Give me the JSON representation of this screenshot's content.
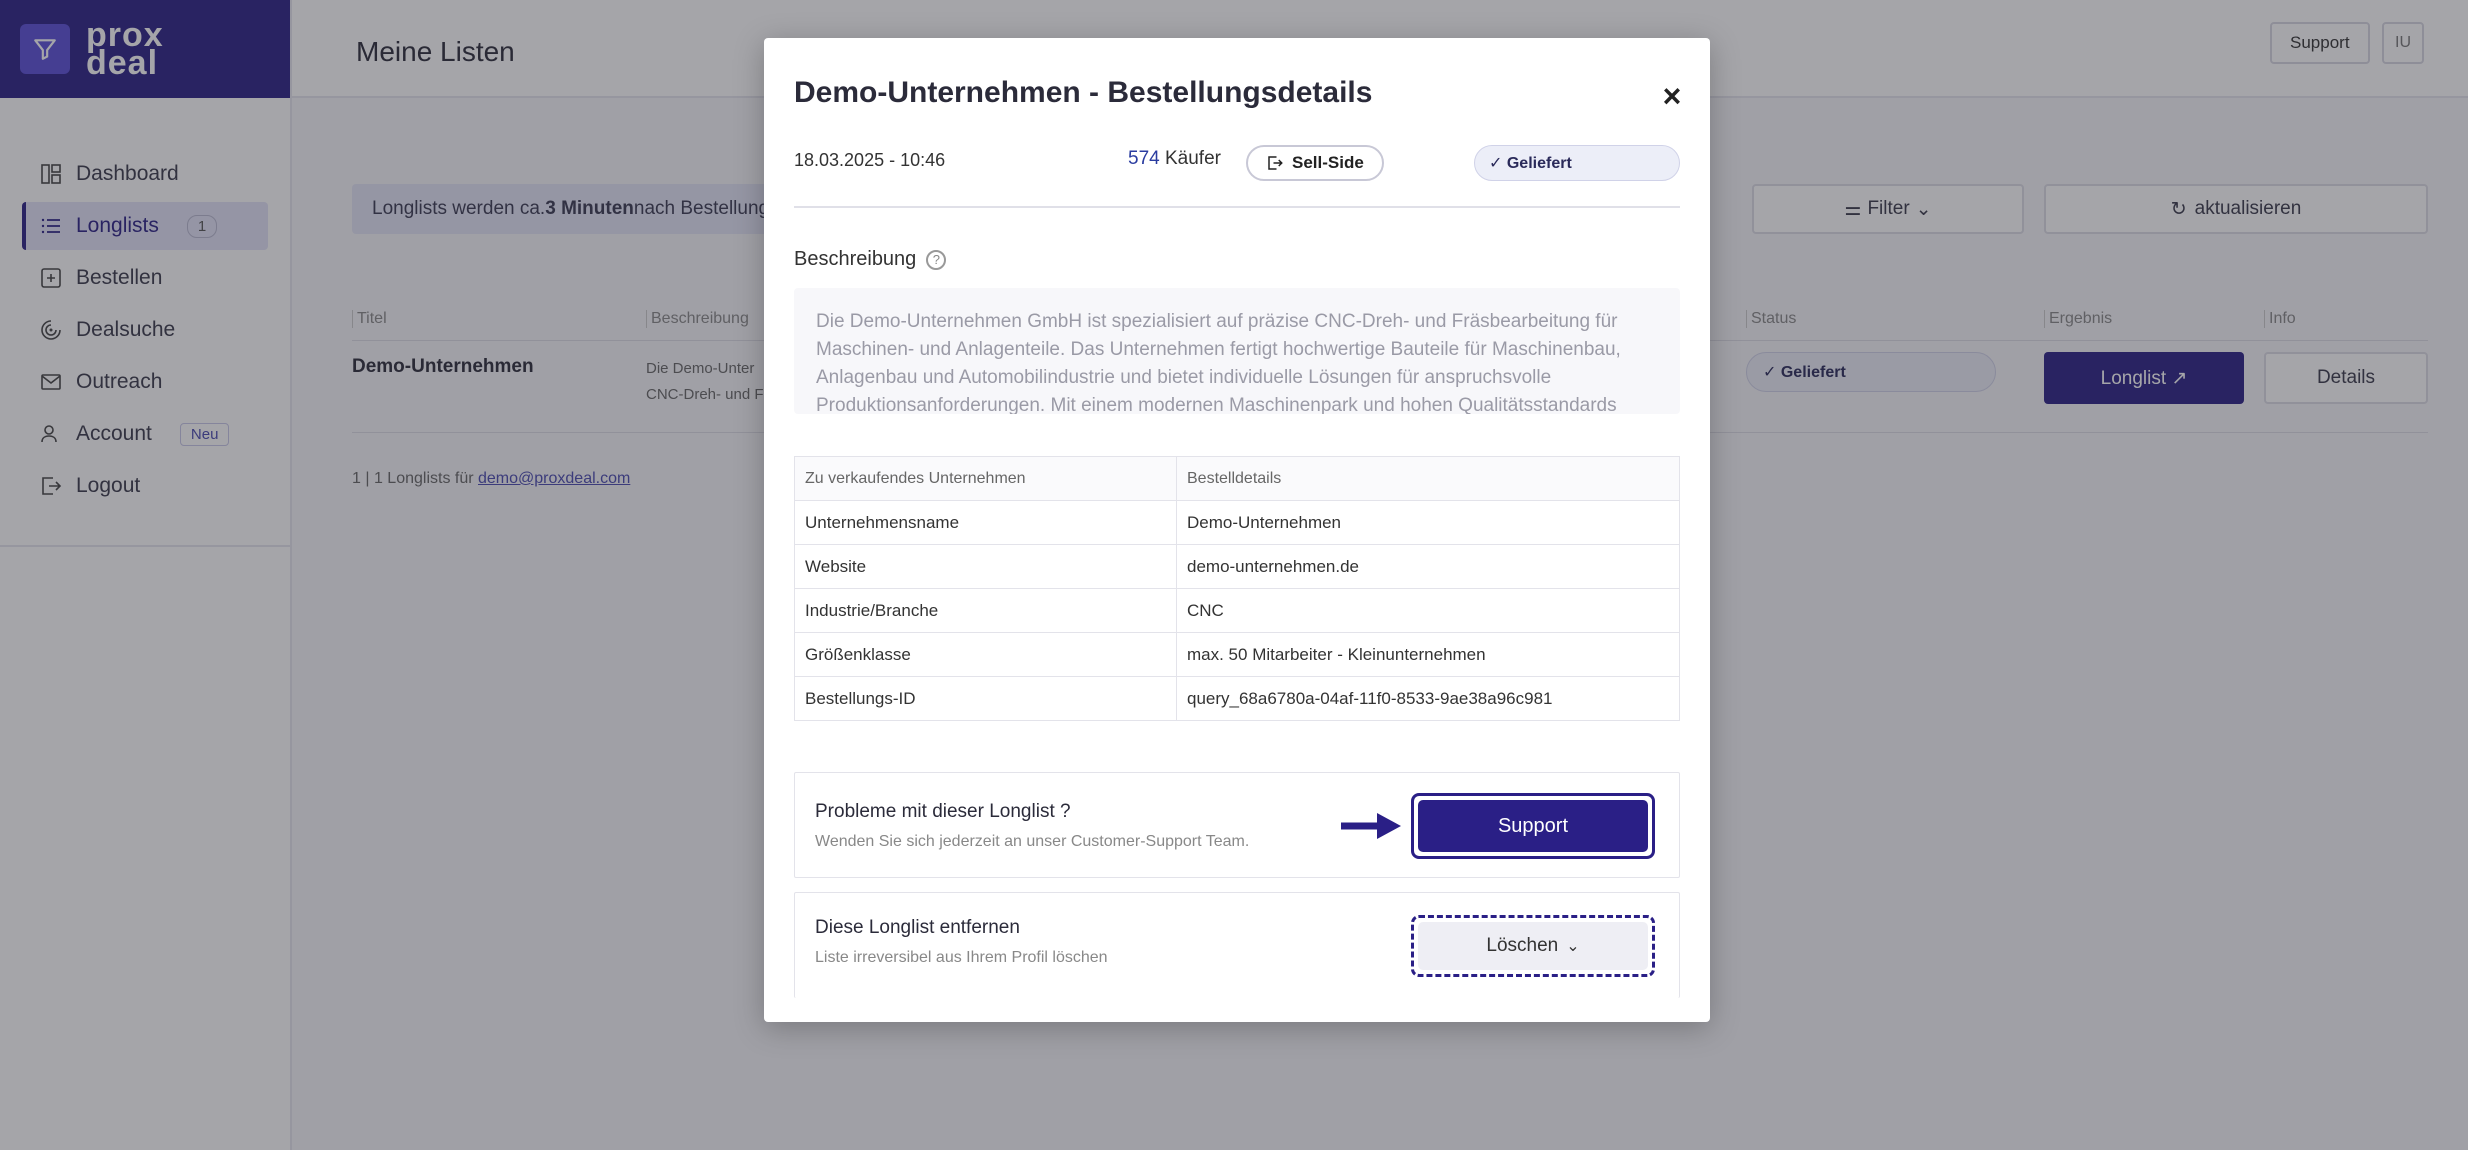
{
  "brand": {
    "line1": "prox",
    "line2": "deal"
  },
  "sidebar": {
    "items": [
      {
        "label": "Dashboard",
        "icon": "dashboard-icon"
      },
      {
        "label": "Longlists",
        "icon": "list-icon",
        "badge": "1"
      },
      {
        "label": "Bestellen",
        "icon": "plus-square-icon"
      },
      {
        "label": "Dealsuche",
        "icon": "radar-icon"
      },
      {
        "label": "Outreach",
        "icon": "mail-icon"
      },
      {
        "label": "Account",
        "icon": "user-icon",
        "tag": "Neu"
      },
      {
        "label": "Logout",
        "icon": "logout-icon"
      }
    ]
  },
  "header": {
    "title": "Meine Listen",
    "support": "Support",
    "avatar": "IU"
  },
  "main": {
    "banner_prefix": "Longlists werden ca. ",
    "banner_bold": "3 Minuten",
    "banner_suffix": " nach Bestellung",
    "filter": "Filter",
    "refresh": "aktualisieren",
    "columns": {
      "title": "Titel",
      "description": "Beschreibung",
      "status": "Status",
      "result": "Ergebnis",
      "info": "Info"
    },
    "row": {
      "title": "Demo-Unternehmen",
      "desc_line1": "Die Demo-Unter",
      "desc_line2": "CNC-Dreh- und F",
      "status": "✓ Geliefert",
      "longlist": "Longlist ↗",
      "details": "Details"
    },
    "footer_prefix": "1 | 1 Longlists für ",
    "footer_email": "demo@proxdeal.com"
  },
  "modal": {
    "title": "Demo-Unternehmen - Bestellungsdetails",
    "close": "×",
    "date": "18.03.2025 - 10:46",
    "buyers_count": "574",
    "buyers_label": " Käufer",
    "sellside": "Sell-Side",
    "status": "✓ Geliefert",
    "desc_label": "Beschreibung",
    "description": "Die Demo-Unternehmen GmbH ist spezialisiert auf präzise CNC-Dreh- und Fräsbearbeitung für Maschinen- und Anlagenteile. Das Unternehmen fertigt hochwertige Bauteile für Maschinenbau, Anlagenbau und Automobilindustrie und bietet individuelle Lösungen für anspruchsvolle Produktionsanforderungen. Mit einem modernen Maschinenpark und hohen Qualitätsstandards",
    "table": {
      "headers": [
        "Zu verkaufendes Unternehmen",
        "Bestelldetails"
      ],
      "rows": [
        [
          "Unternehmensname",
          " Demo-Unternehmen"
        ],
        [
          "Website",
          "demo-unternehmen.de"
        ],
        [
          "Industrie/Branche",
          "CNC"
        ],
        [
          "Größenklasse",
          "max. 50 Mitarbeiter - Kleinunternehmen"
        ],
        [
          "Bestellungs-ID",
          "query_68a6780a-04af-11f0-8533-9ae38a96c981"
        ]
      ]
    },
    "support_card": {
      "title": "Probleme mit dieser Longlist ?",
      "subtitle": "Wenden Sie sich jederzeit an unser Customer-Support Team.",
      "button": "Support"
    },
    "delete_card": {
      "title": "Diese Longlist entfernen",
      "subtitle": "Liste irreversibel aus Ihrem Profil löschen",
      "button": "Löschen"
    }
  },
  "colors": {
    "brand": "#2a1f86",
    "accent": "#5a4fd8",
    "overlay": "rgba(40,40,50,0.42)"
  }
}
